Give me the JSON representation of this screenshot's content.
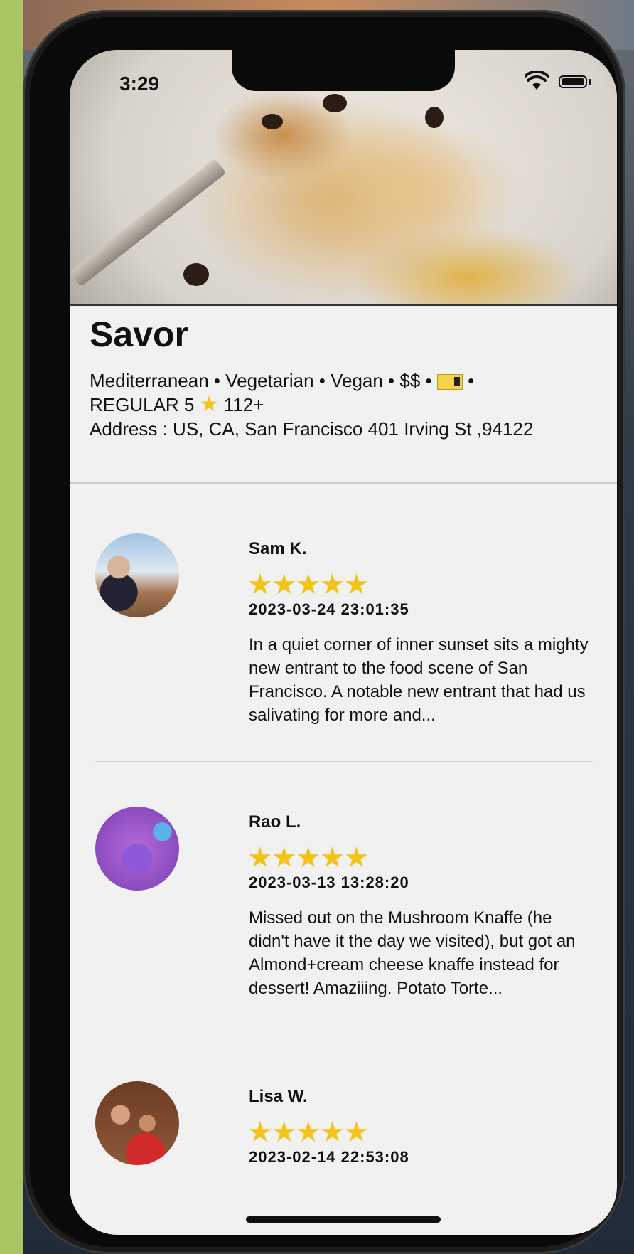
{
  "status_bar": {
    "time": "3:29"
  },
  "restaurant": {
    "name": "Savor",
    "categories": "Mediterranean • Vegetarian • Vegan  • $$ •",
    "rating_line": "REGULAR 5",
    "review_count": "112+",
    "address": "Address : US, CA, San Francisco  401 Irving St ,94122"
  },
  "reviews": [
    {
      "name": "Sam K.",
      "stars": "★★★★★",
      "date": "2023-03-24 23:01:35",
      "text": "In a quiet corner of inner sunset sits a mighty new entrant to the food scene of San Francisco. A notable new entrant that had us salivating for more and..."
    },
    {
      "name": "Rao L.",
      "stars": "★★★★★",
      "date": "2023-03-13 13:28:20",
      "text": "Missed out on the Mushroom Knaffe (he didn't have it the day we visited), but got an Almond+cream cheese knaffe instead for dessert! Amaziiing. Potato Torte..."
    },
    {
      "name": "Lisa W.",
      "stars": "★★★★★",
      "date": "2023-02-14 22:53:08",
      "text": ""
    }
  ],
  "colors": {
    "star": "#f4c31a",
    "background": "#f1f1f1"
  }
}
